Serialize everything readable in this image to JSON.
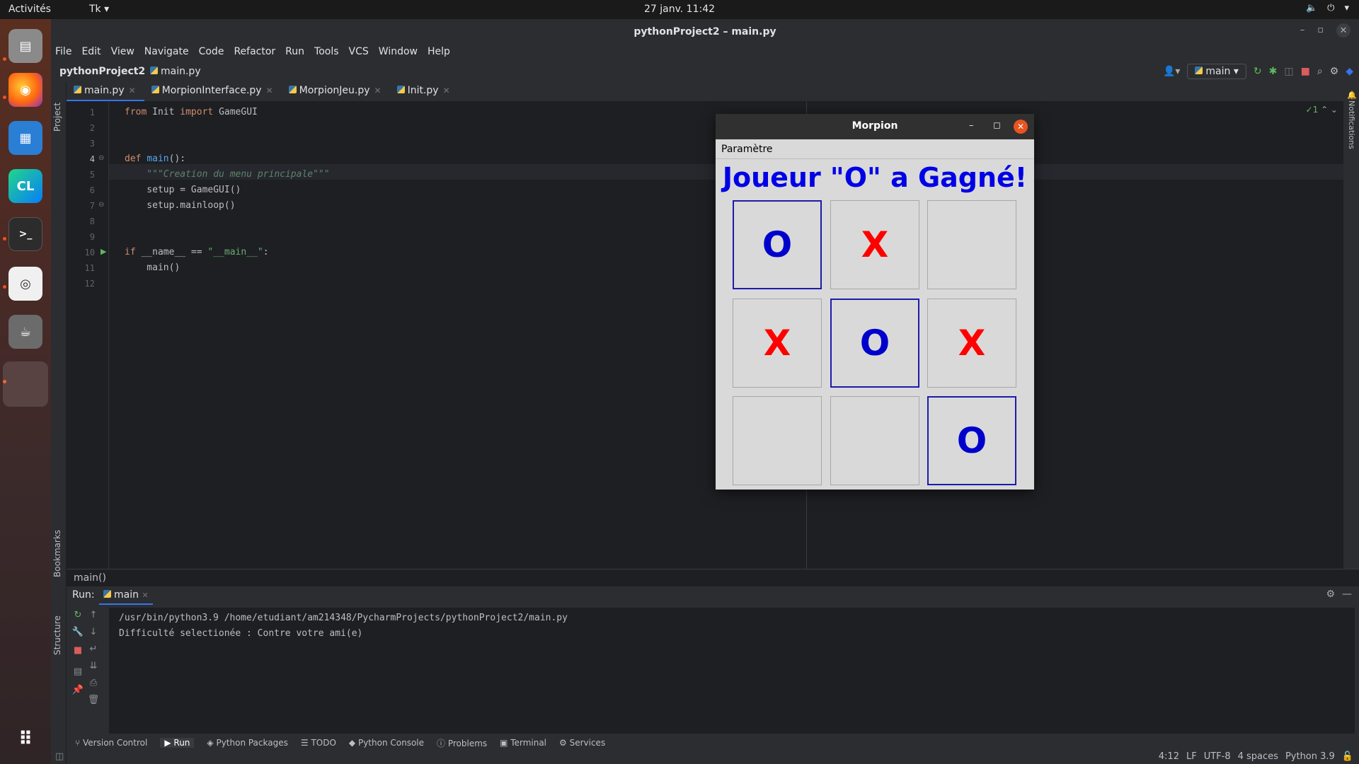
{
  "topbar": {
    "activities": "Activités",
    "app": "Tk",
    "clock": "27 janv.  11:42"
  },
  "ide": {
    "title": "pythonProject2 – main.py",
    "menu": [
      "File",
      "Edit",
      "View",
      "Navigate",
      "Code",
      "Refactor",
      "Run",
      "Tools",
      "VCS",
      "Window",
      "Help"
    ],
    "project": "pythonProject2",
    "file": "main.py",
    "run_config": "main",
    "left_tools": {
      "project": "Project",
      "bookmarks": "Bookmarks",
      "structure": "Structure"
    },
    "right_tool": "Notifications",
    "tabs": [
      "main.py",
      "MorpionInterface.py",
      "MorpionJeu.py",
      "Init.py"
    ],
    "inspection": "1",
    "line_numbers": [
      "1",
      "2",
      "3",
      "4",
      "5",
      "6",
      "7",
      "8",
      "9",
      "10",
      "11",
      "12"
    ],
    "code": {
      "l1": {
        "a": "from",
        "b": " Init ",
        "c": "import",
        "d": " GameGUI"
      },
      "l4": {
        "a": "def ",
        "b": "main",
        "c": "():"
      },
      "l5": "    \"\"\"Creation du menu principale\"\"\"",
      "l6": "    setup = GameGUI()",
      "l7": "    setup.mainloop()",
      "l10": {
        "a": "if",
        "b": " __name__ == ",
        "c": "\"__main__\"",
        "d": ":"
      },
      "l11": "    main()"
    },
    "breadcrumb": "main()",
    "run": {
      "label": "Run:",
      "tab": "main",
      "console": [
        "/usr/bin/python3.9 /home/etudiant/am214348/PycharmProjects/pythonProject2/main.py",
        "Difficulté selectionée : Contre votre ami(e)"
      ]
    },
    "bottom_tools": [
      "Version Control",
      "Run",
      "Python Packages",
      "TODO",
      "Python Console",
      "Problems",
      "Terminal",
      "Services"
    ],
    "status": {
      "pos": "4:12",
      "eol": "LF",
      "enc": "UTF-8",
      "indent": "4 spaces",
      "interp": "Python 3.9"
    }
  },
  "morpion": {
    "title": "Morpion",
    "menu": "Paramètre",
    "status": "Joueur \"O\" a Gagné!",
    "board": [
      "O",
      "X",
      "",
      "X",
      "O",
      "X",
      "",
      "",
      "O"
    ]
  },
  "colors": {
    "o_mark": "#0000cc",
    "x_mark": "#ff0000",
    "status_text": "#0000e6",
    "accent": "#3574f0"
  }
}
